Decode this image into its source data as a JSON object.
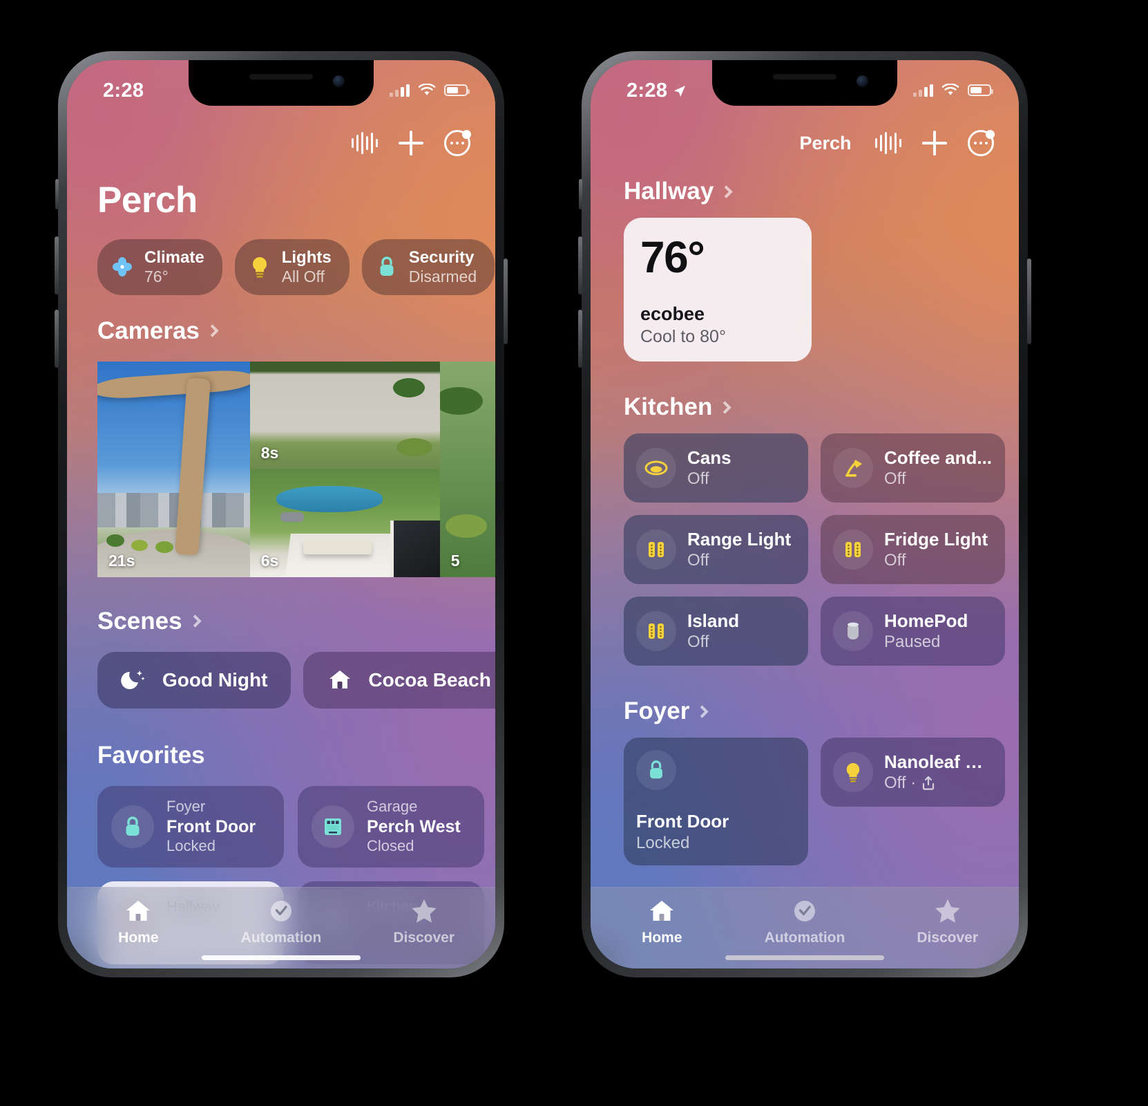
{
  "left_phone": {
    "status_bar": {
      "time": "2:28",
      "battery_icon": "battery-icon",
      "wifi_icon": "wifi-icon",
      "cellular_icon": "cellular-bars-icon"
    },
    "nav": {
      "waveform_icon": "siri-waveform-icon",
      "add_icon": "plus-icon",
      "more_icon": "more-circle-icon"
    },
    "page_title": "Perch",
    "status_pills": [
      {
        "title": "Climate",
        "sub": "76°",
        "icon": "fan-icon"
      },
      {
        "title": "Lights",
        "sub": "All Off",
        "icon": "lightbulb-icon"
      },
      {
        "title": "Security",
        "sub": "Disarmed",
        "icon": "lock-icon"
      },
      {
        "title": "",
        "sub": "",
        "icon": "partial-pill-icon"
      }
    ],
    "cameras": {
      "header": "Cameras",
      "chevron_icon": "chevron-right-icon",
      "items": [
        {
          "name": "front-porch-camera",
          "time": "21s"
        },
        {
          "name": "driveway-camera",
          "time": "8s"
        },
        {
          "name": "backyard-camera",
          "time": "6s"
        },
        {
          "name": "side-yard-camera",
          "time": "5"
        }
      ]
    },
    "scenes": {
      "header": "Scenes",
      "chevron_icon": "chevron-right-icon",
      "items": [
        {
          "label": "Good Night",
          "icon": "moon-stars-icon"
        },
        {
          "label": "Cocoa Beach",
          "icon": "house-icon"
        },
        {
          "label": "",
          "icon": "house-icon"
        }
      ]
    },
    "favorites": {
      "header": "Favorites",
      "items": [
        {
          "room": "Foyer",
          "name": "Front Door",
          "state": "Locked",
          "icon": "lock-icon",
          "style": "dark"
        },
        {
          "room": "Garage",
          "name": "Perch West",
          "state": "Closed",
          "icon": "garage-door-icon",
          "style": "dark"
        },
        {
          "room": "Hallway",
          "name": "",
          "state": "",
          "icon": "thermostat-icon",
          "style": "light"
        },
        {
          "room": "Kitchen",
          "name": "",
          "state": "",
          "icon": "light-icon",
          "style": "dark"
        }
      ]
    },
    "tabs": [
      {
        "label": "Home",
        "icon": "house-icon",
        "active": true
      },
      {
        "label": "Automation",
        "icon": "automation-clock-icon",
        "active": false
      },
      {
        "label": "Discover",
        "icon": "star-icon",
        "active": false
      }
    ]
  },
  "right_phone": {
    "status_bar": {
      "time": "2:28",
      "location_icon": "location-arrow-icon",
      "battery_icon": "battery-icon",
      "wifi_icon": "wifi-icon",
      "cellular_icon": "cellular-bars-icon"
    },
    "nav": {
      "title": "Perch",
      "waveform_icon": "siri-waveform-icon",
      "add_icon": "plus-icon",
      "more_icon": "more-circle-icon"
    },
    "sections": [
      {
        "header": "Hallway",
        "chevron_icon": "chevron-right-icon",
        "thermostat": {
          "temperature": "76°",
          "name": "ecobee",
          "state": "Cool to 80°"
        }
      },
      {
        "header": "Kitchen",
        "chevron_icon": "chevron-right-icon",
        "tiles": [
          {
            "name": "Cans",
            "state": "Off",
            "icon": "recessed-can-light-icon",
            "tone": "cool"
          },
          {
            "name": "Coffee and...",
            "state": "Off",
            "icon": "desk-lamp-icon",
            "tone": "warm"
          },
          {
            "name": "Range Light",
            "state": "Off",
            "icon": "strip-light-icon",
            "tone": "cool"
          },
          {
            "name": "Fridge Light",
            "state": "Off",
            "icon": "strip-light-icon",
            "tone": "warm"
          },
          {
            "name": "Island",
            "state": "Off",
            "icon": "strip-light-icon",
            "tone": "cool"
          },
          {
            "name": "HomePod",
            "state": "Paused",
            "icon": "homepod-icon",
            "tone": "violet"
          }
        ]
      },
      {
        "header": "Foyer",
        "chevron_icon": "chevron-right-icon",
        "tiles": [
          {
            "name": "Front Door",
            "state": "Locked",
            "icon": "lock-icon",
            "tone": "cool",
            "tall": true
          },
          {
            "name": "Nanoleaf Es...",
            "state": "Off ·",
            "state_suffix_icon": "share-up-icon",
            "icon": "lightbulb-icon",
            "tone": "violet"
          }
        ]
      }
    ],
    "tabs": [
      {
        "label": "Home",
        "icon": "house-icon",
        "active": true
      },
      {
        "label": "Automation",
        "icon": "automation-clock-icon",
        "active": false
      },
      {
        "label": "Discover",
        "icon": "star-icon",
        "active": false
      }
    ]
  },
  "colors": {
    "accent_yellow": "#F5D13B",
    "accent_teal": "#7BE0D6",
    "accent_blue": "#6FC3F7",
    "card_light": "#F6F3F7"
  }
}
